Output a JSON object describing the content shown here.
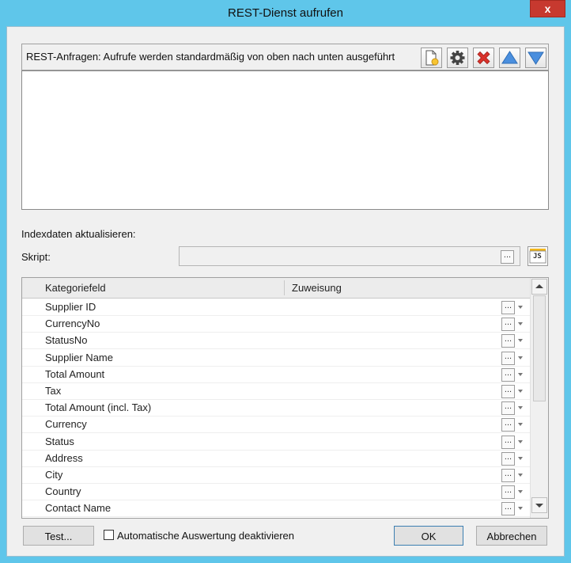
{
  "window": {
    "title": "REST-Dienst aufrufen",
    "close_label": "x"
  },
  "requests": {
    "label": "REST-Anfragen: Aufrufe werden standardmäßig von oben nach unten ausgeführt",
    "toolbar_icons": [
      "new-document-icon",
      "gear-icon",
      "delete-icon",
      "move-up-icon",
      "move-down-icon"
    ]
  },
  "index": {
    "heading": "Indexdaten aktualisieren:",
    "script_label": "Skript:",
    "script_value": "",
    "ellipsis": "...",
    "js_label": "JS"
  },
  "grid": {
    "columns": [
      "Kategoriefeld",
      "Zuweisung"
    ],
    "rows": [
      {
        "field": "Supplier ID",
        "assignment": ""
      },
      {
        "field": "CurrencyNo",
        "assignment": ""
      },
      {
        "field": "StatusNo",
        "assignment": ""
      },
      {
        "field": "Supplier Name",
        "assignment": ""
      },
      {
        "field": "Total Amount",
        "assignment": ""
      },
      {
        "field": "Tax",
        "assignment": ""
      },
      {
        "field": "Total Amount (incl. Tax)",
        "assignment": ""
      },
      {
        "field": "Currency",
        "assignment": ""
      },
      {
        "field": "Status",
        "assignment": ""
      },
      {
        "field": "Address",
        "assignment": ""
      },
      {
        "field": "City",
        "assignment": ""
      },
      {
        "field": "Country",
        "assignment": ""
      },
      {
        "field": "Contact Name",
        "assignment": ""
      }
    ],
    "ellipsis": "..."
  },
  "footer": {
    "test_label": "Test...",
    "auto_eval_label": "Automatische Auswertung deaktivieren",
    "auto_eval_checked": false,
    "ok_label": "OK",
    "cancel_label": "Abbrechen"
  },
  "colors": {
    "titlebar": "#5fc6ea",
    "close": "#c7392f",
    "delete_red": "#d9322b",
    "arrow_blue": "#4a8fde"
  }
}
